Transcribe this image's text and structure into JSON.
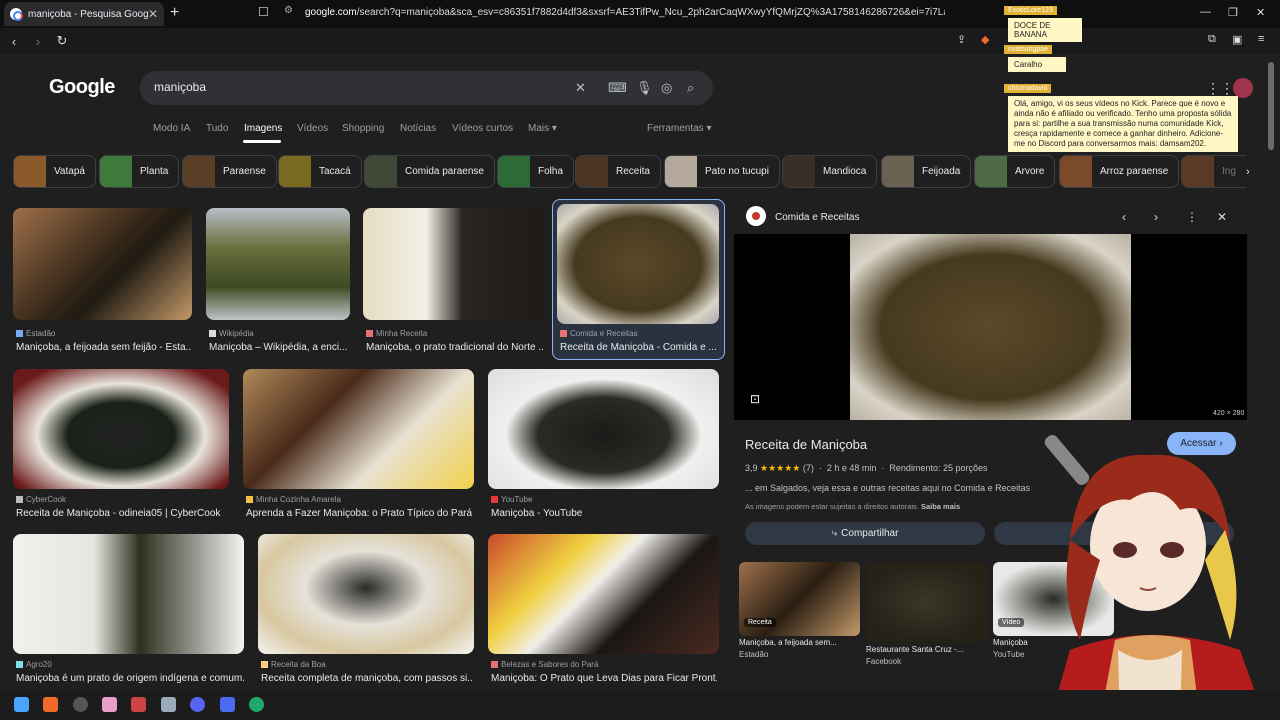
{
  "browser": {
    "tab_title": "maniçoba - Pesquisa Google",
    "tab_close": "✕",
    "new_tab": "+",
    "url_host": "google.com",
    "url_rest": "/search?q=maniçoba&sca_esv=c86351f7882d4df3&sxsrf=AE3TifPw_Ncu_2ph2arCaqWXwyYfQMrjZQ%3A1758146286726&ei=7i7LaKaILLCJSO..."
  },
  "chat": [
    {
      "name": "ExoticLore123",
      "message": "DOCE DE BANANA"
    },
    {
      "name": "ovatsungpae",
      "message": "Caralho"
    },
    {
      "name": "chlomadavid",
      "message": "Olá, amigo, vi os seus vídeos no Kick. Parece que é novo e ainda não é afiliado ou verificado. Tenho uma proposta sólida para si: partilhe a sua transmissão numa comunidade Kick, cresça rapidamente e comece a ganhar dinheiro. Adicione-me no Discord para conversarmos mais: damsam202."
    }
  ],
  "google": {
    "logo": "Google",
    "query": "maniçoba",
    "nav": [
      "Modo IA",
      "Tudo",
      "Imagens",
      "Vídeos",
      "Shopping",
      "Notícias",
      "Vídeos curtos",
      "Mais ▾"
    ],
    "tools": "Ferramentas ▾",
    "chips": [
      "Vatapá",
      "Planta",
      "Paraense",
      "Tacacá",
      "Comida paraense",
      "Folha",
      "Receita",
      "Pato no tucupi",
      "Mandioca",
      "Feijoada",
      "Arvore",
      "Arroz paraense",
      "Ing"
    ]
  },
  "results": [
    {
      "source": "Estadão",
      "title": "Maniçoba, a feijoada sem feijão - Esta..."
    },
    {
      "source": "Wikipédia",
      "title": "Maniçoba – Wikipédia, a enci..."
    },
    {
      "source": "Minha Receita",
      "title": "Maniçoba, o prato tradicional do Norte ..."
    },
    {
      "source": "Comida e Receitas",
      "title": "Receita de Maniçoba - Comida e ..."
    },
    {
      "source": "CyberCook",
      "title": "Receita de Maniçoba - odineia05 | CyberCook"
    },
    {
      "source": "Minha Cozinha Amarela",
      "title": "Aprenda a Fazer Maniçoba: o Prato Típico do Pará..."
    },
    {
      "source": "YouTube",
      "title": "Maniçoba - YouTube"
    },
    {
      "source": "Agro20",
      "title": "Maniçoba é um prato de origem indígena e comum..."
    },
    {
      "source": "Receita da Boa",
      "title": "Receita completa de maniçoba, com passos si..."
    },
    {
      "source": "Belezas e Sabores do Pará",
      "title": "Maniçoba: O Prato que Leva Dias para Ficar Pront..."
    }
  ],
  "panel": {
    "source": "Comida e Receitas",
    "dims": "420 × 280",
    "title": "Receita de Maniçoba",
    "visit": "Acessar ›",
    "rating": "3,9",
    "stars": "★★★★★",
    "reviews": "(7)",
    "time": "2 h e 48 min",
    "yield": "Rendimento: 25 porções",
    "description": "... em Salgados, veja essa e outras receitas aqui no Comida e Receitas",
    "copyright": "As imagens podem estar sujeitas a direitos autorais.",
    "learn_more": "Saiba mais",
    "share": "Compartilhar",
    "related": [
      {
        "tag": "Receita",
        "title": "Maniçoba, a feijoada sem...",
        "source": "Estadão"
      },
      {
        "tag": "",
        "title": "Restaurante Santa Cruz -...",
        "source": "Facebook"
      },
      {
        "tag": "Vídeo",
        "title": "Maniçoba",
        "source": "YouTube"
      }
    ]
  },
  "colors": {
    "accent": "#8ab4f8",
    "background": "#1f1f1f",
    "star": "#fbbc04"
  }
}
